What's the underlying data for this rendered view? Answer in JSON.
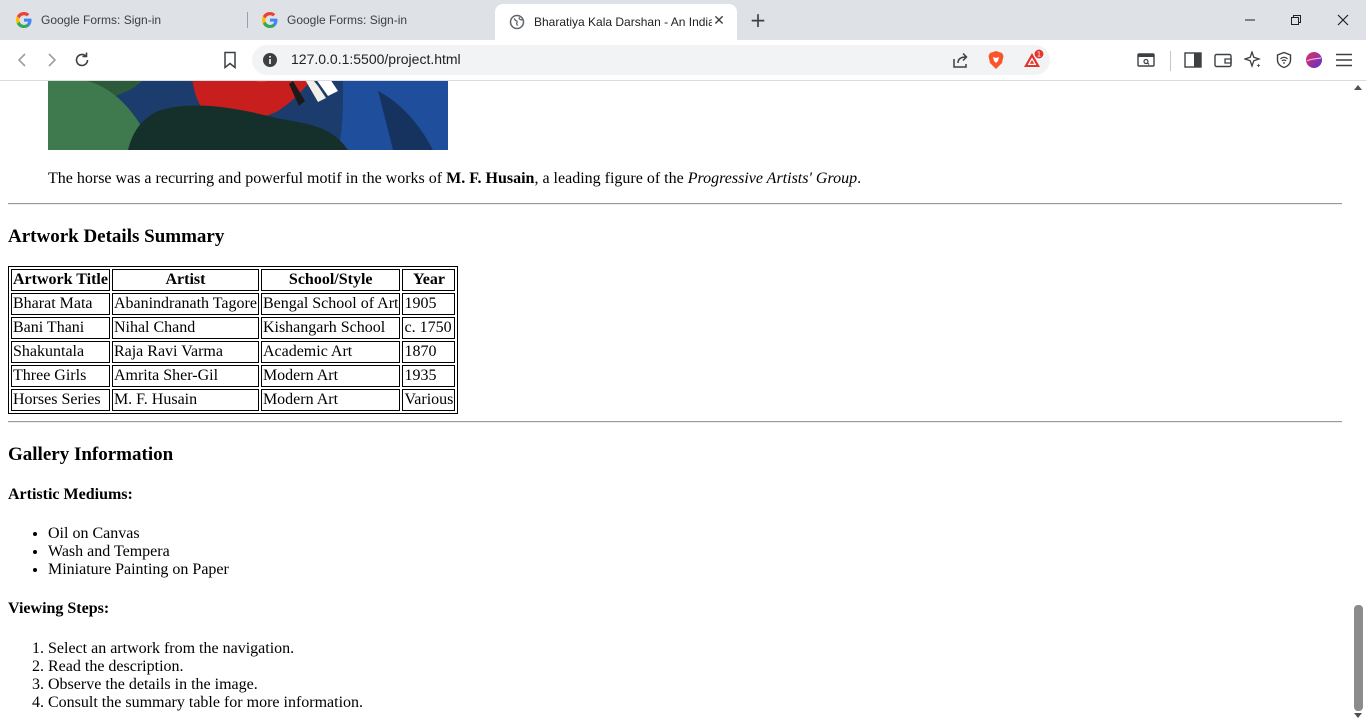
{
  "browser": {
    "tabs": [
      {
        "title": "Google Forms: Sign-in",
        "favicon": "google-g-icon",
        "active": false
      },
      {
        "title": "Google Forms: Sign-in",
        "favicon": "google-g-icon",
        "active": false
      },
      {
        "title": "Bharatiya Kala Darshan - An India",
        "favicon": "globe-icon",
        "active": true
      }
    ],
    "url": "127.0.0.1:5500/project.html",
    "brave_rewards_badge": "1",
    "colors": {
      "brave_orange": "#fb542b",
      "rewards_red": "#e2352e",
      "tab_strip": "#dee1e6"
    }
  },
  "page": {
    "caption": {
      "before": "The horse was a recurring and powerful motif in the works of ",
      "artist": "M. F. Husain",
      "middle": ", a leading figure of the ",
      "group": "Progressive Artists' Group",
      "after": "."
    },
    "summary_heading": "Artwork Details Summary",
    "table": {
      "headers": [
        "Artwork Title",
        "Artist",
        "School/Style",
        "Year"
      ],
      "rows": [
        [
          "Bharat Mata",
          "Abanindranath Tagore",
          "Bengal School of Art",
          "1905"
        ],
        [
          "Bani Thani",
          "Nihal Chand",
          "Kishangarh School",
          "c. 1750"
        ],
        [
          "Shakuntala",
          "Raja Ravi Varma",
          "Academic Art",
          "1870"
        ],
        [
          "Three Girls",
          "Amrita Sher-Gil",
          "Modern Art",
          "1935"
        ],
        [
          "Horses Series",
          "M. F. Husain",
          "Modern Art",
          "Various"
        ]
      ]
    },
    "gallery_heading": "Gallery Information",
    "mediums_heading": "Artistic Mediums:",
    "mediums": [
      "Oil on Canvas",
      "Wash and Tempera",
      "Miniature Painting on Paper"
    ],
    "steps_heading": "Viewing Steps:",
    "steps": [
      "Select an artwork from the navigation.",
      "Read the description.",
      "Observe the details in the image.",
      "Consult the summary table for more information."
    ]
  }
}
